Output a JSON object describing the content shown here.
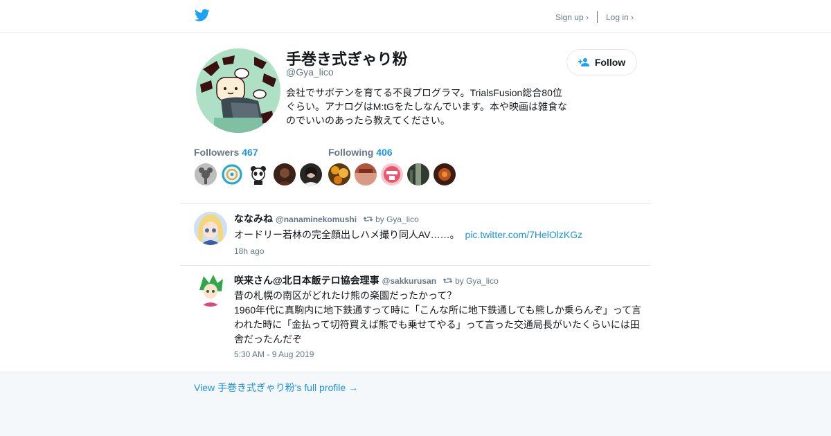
{
  "header": {
    "logo_icon": "twitter-bird-icon",
    "signup_label": "Sign up ›",
    "login_label": "Log in ›"
  },
  "profile": {
    "name": "手巻き式ぎゃり粉",
    "handle": "@Gya_lico",
    "bio": "会社でサボテンを育てる不良プログラマ。TrialsFusion総合80位ぐらい。アナログはM:tGをたしなんでいます。本や映画は雑食なのでいいのあったら教えてください。",
    "follow_label": "Follow",
    "follow_icon": "follow-person-plus-icon"
  },
  "stats": {
    "followers_label": "Followers",
    "followers_count": "467",
    "following_label": "Following",
    "following_count": "406"
  },
  "tweets": [
    {
      "name": "ななみね",
      "handle": "@nanaminekomushi",
      "retweet_by": "by Gya_lico",
      "text": "オードリー若林の完全顔出しハメ撮り同人AV……。",
      "link": "pic.twitter.com/7HelOlzKGz",
      "time": "18h ago"
    },
    {
      "name": "咲来さん@北日本飯テロ協会理事",
      "handle": "@sakkurusan",
      "retweet_by": "by Gya_lico",
      "text_line1": "昔の札幌の南区がどれたけ熊の楽園だったかって？",
      "text_line2": "1960年代に真駒内に地下鉄通すって時に「こんな所に地下鉄通しても熊しか乗らんぞ」って言われた時に「金払って切符買えば熊でも乗せてやる」って言った交通局長がいたくらいには田舎だったんだぞ",
      "time": "5:30 AM - 9 Aug 2019"
    }
  ],
  "footer": {
    "full_profile_label": "View 手巻き式ぎゃり粉's full profile →"
  },
  "colors": {
    "link": "#1b95e0",
    "muted": "#657786",
    "border": "#e1e8ed",
    "footer_bg": "#f5f8fa",
    "twitter_blue": "#1da1f2"
  }
}
